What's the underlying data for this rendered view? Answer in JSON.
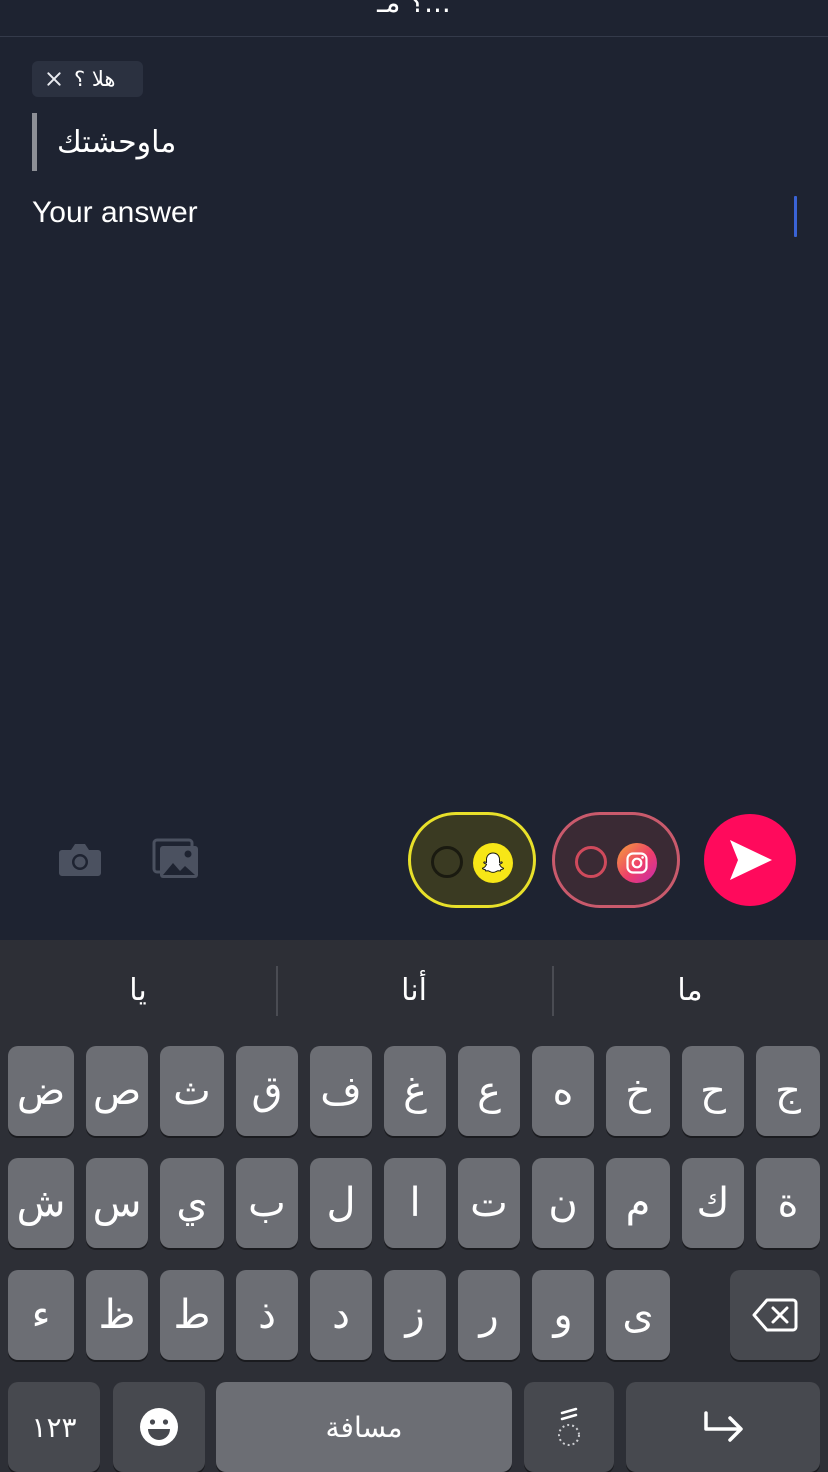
{
  "header": {
    "title": "؟ مـ..."
  },
  "question_chip": {
    "text": "هلا ؟",
    "close_icon": "close-icon"
  },
  "quote": {
    "text": "ماوحشتك"
  },
  "answer_input": {
    "value": "",
    "placeholder": "Your answer"
  },
  "actions": {
    "camera_icon": "camera-icon",
    "gallery_icon": "gallery-icon",
    "share_snapchat": {
      "icon": "snapchat-icon",
      "checked": false,
      "accent": "#e8e02a"
    },
    "share_instagram": {
      "icon": "instagram-icon",
      "checked": false,
      "accent": "#ee3e6b"
    },
    "send": {
      "icon": "send-icon",
      "color": "#ff0a5c"
    }
  },
  "keyboard": {
    "suggestions": [
      "يا",
      "أنا",
      "ما"
    ],
    "row1": [
      "ض",
      "ص",
      "ث",
      "ق",
      "ف",
      "غ",
      "ع",
      "ه",
      "خ",
      "ح",
      "ج"
    ],
    "row2": [
      "ش",
      "س",
      "ي",
      "ب",
      "ل",
      "ا",
      "ت",
      "ن",
      "م",
      "ك",
      "ة"
    ],
    "row3": [
      "ء",
      "ظ",
      "ط",
      "ذ",
      "د",
      "ز",
      "ر",
      "و",
      "ى"
    ],
    "numbers_label": "١٢٣",
    "space_label": "مسافة",
    "diacritic_label": "ً",
    "backspace_icon": "backspace-icon",
    "emoji_icon": "emoji-icon",
    "return_icon": "return-icon"
  }
}
